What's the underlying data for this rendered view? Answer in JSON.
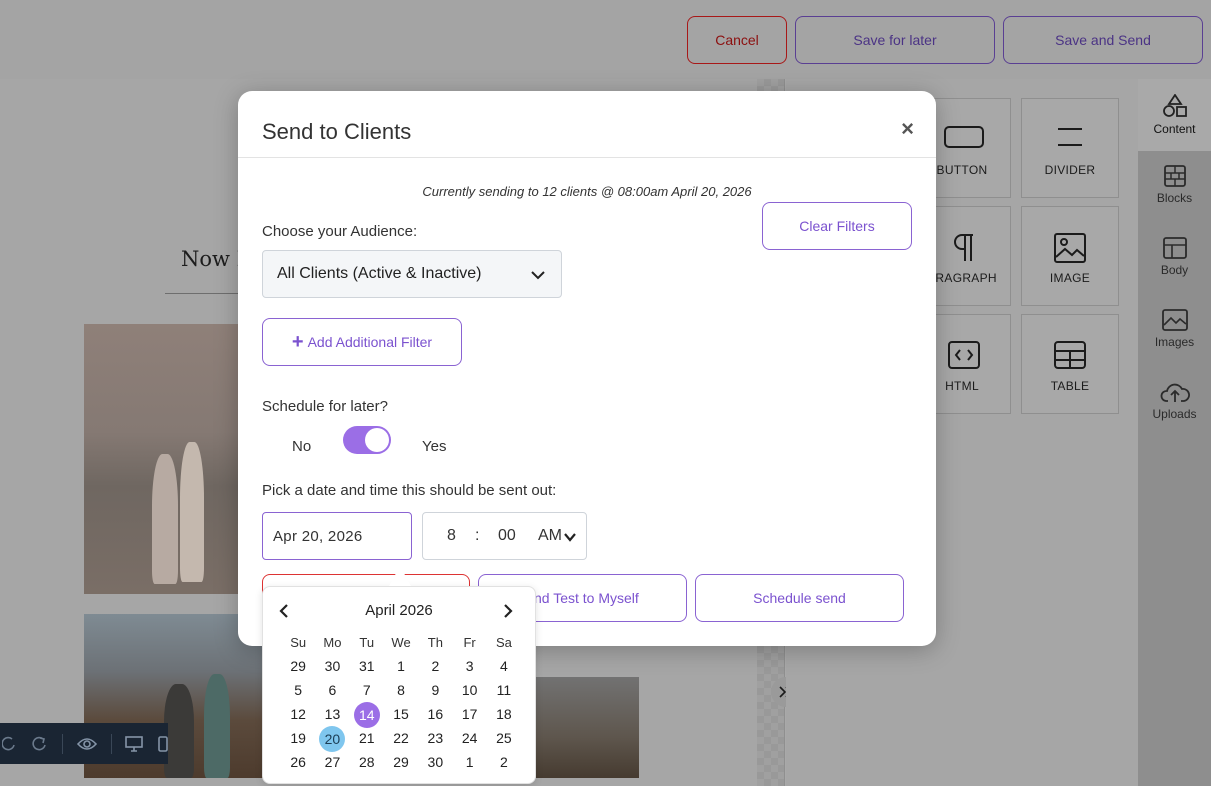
{
  "topbar": {
    "cancel": "Cancel",
    "save_later": "Save for later",
    "save_send": "Save and Send"
  },
  "canvas": {
    "heading": "Now P"
  },
  "content_tiles": [
    {
      "label": "BUTTON",
      "icon": "button-icon"
    },
    {
      "label": "DIVIDER",
      "icon": "divider-icon"
    },
    {
      "label": "ARAGRAPH",
      "icon": "paragraph-icon"
    },
    {
      "label": "IMAGE",
      "icon": "image-icon"
    },
    {
      "label": "HTML",
      "icon": "html-icon"
    },
    {
      "label": "TABLE",
      "icon": "table-icon"
    }
  ],
  "side_tabs": [
    {
      "label": "Content",
      "icon": "shapes-icon"
    },
    {
      "label": "Blocks",
      "icon": "blocks-icon"
    },
    {
      "label": "Body",
      "icon": "layout-icon"
    },
    {
      "label": "Images",
      "icon": "images-icon"
    },
    {
      "label": "Uploads",
      "icon": "cloud-upload-icon"
    }
  ],
  "modal": {
    "title": "Send to Clients",
    "close": "×",
    "status": "Currently sending to 12 clients @ 08:00am April 20, 2026",
    "audience_label": "Choose your Audience:",
    "audience_value": "All Clients (Active & Inactive)",
    "clear_filters": "Clear Filters",
    "add_filter": "Add Additional Filter",
    "schedule_label": "Schedule for later?",
    "toggle_no": "No",
    "toggle_yes": "Yes",
    "toggle_on": true,
    "pick_label": "Pick a date and time this should be sent out:",
    "date_value": "Apr 20, 2026",
    "time_hour": "8",
    "time_sep": ":",
    "time_minute": "00",
    "time_ampm": "AM",
    "send_test": "end Test to Myself",
    "schedule_send": "Schedule send"
  },
  "calendar": {
    "title": "April 2026",
    "weekdays": [
      "Su",
      "Mo",
      "Tu",
      "We",
      "Th",
      "Fr",
      "Sa"
    ],
    "days": [
      "29",
      "30",
      "31",
      "1",
      "2",
      "3",
      "4",
      "5",
      "6",
      "7",
      "8",
      "9",
      "10",
      "11",
      "12",
      "13",
      "14",
      "15",
      "16",
      "17",
      "18",
      "19",
      "20",
      "21",
      "22",
      "23",
      "24",
      "25",
      "26",
      "27",
      "28",
      "29",
      "30",
      "1",
      "2"
    ],
    "selected_day": "14",
    "highlighted_day": "20"
  },
  "colors": {
    "accent": "#8a63d2",
    "toggle": "#9b6ee6",
    "danger": "#d33333",
    "today": "#7fc6ee"
  }
}
